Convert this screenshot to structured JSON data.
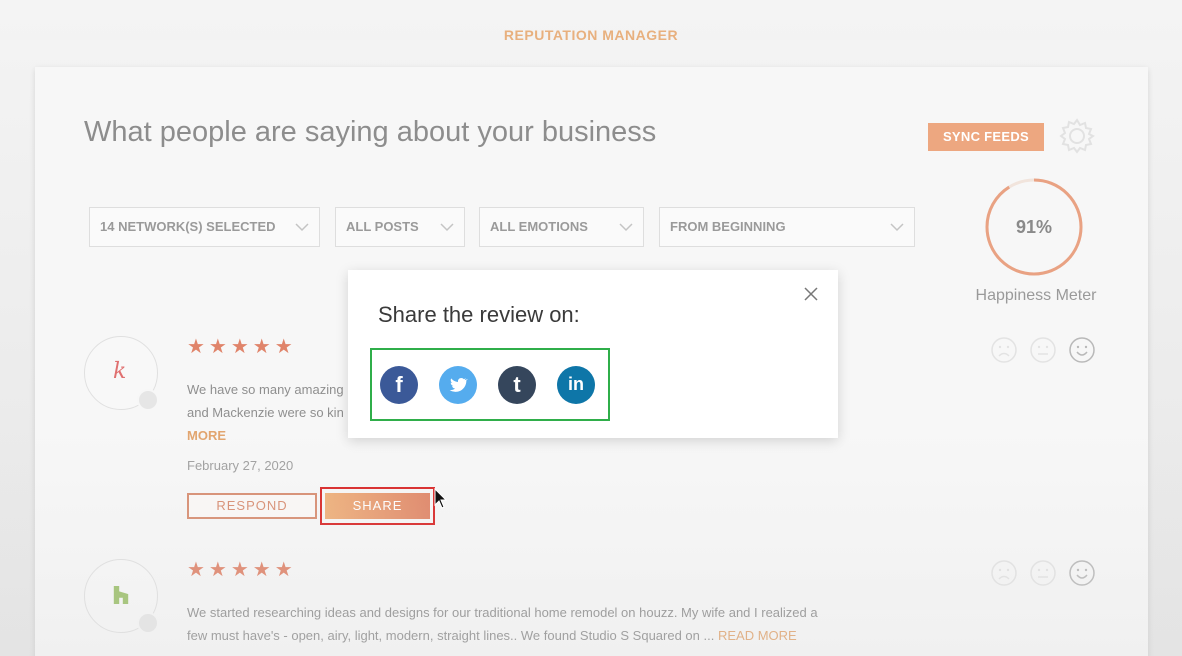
{
  "app": {
    "title": "REPUTATION MANAGER"
  },
  "header": {
    "heading": "What people are saying about your business",
    "sync_label": "SYNC FEEDS"
  },
  "filters": [
    {
      "label": "14 NETWORK(S) SELECTED"
    },
    {
      "label": "ALL POSTS"
    },
    {
      "label": "ALL EMOTIONS"
    },
    {
      "label": "FROM BEGINNING"
    }
  ],
  "happiness_meter": {
    "value": "91%",
    "fraction": 0.91,
    "label": "Happiness Meter"
  },
  "reviews": [
    {
      "avatar_letter": "k",
      "stars": "★★★★★",
      "text_line1": "We have so many amazing",
      "text_line2": "and Mackenzie were so kin",
      "more": "MORE",
      "date": "February 27, 2020",
      "respond_label": "RESPOND",
      "share_label": "SHARE"
    },
    {
      "avatar_letter": "h",
      "stars": "★★★★★",
      "text_line1": "We started researching ideas and designs for our traditional home remodel on houzz. My wife and I realized a",
      "text_line2": "few must have's - open, airy, light, modern, straight lines.. We found Studio S Squared on ...",
      "more": "READ MORE"
    }
  ],
  "share_modal": {
    "title": "Share the review on:",
    "networks": [
      {
        "name": "facebook",
        "glyph": "f",
        "color": "#3b5998"
      },
      {
        "name": "twitter",
        "glyph": "t",
        "color": "#55acee"
      },
      {
        "name": "tumblr",
        "glyph": "t",
        "color": "#35465c"
      },
      {
        "name": "linkedin",
        "glyph": "in",
        "color": "#0e76a8"
      }
    ]
  },
  "colors": {
    "accent": "#eda780",
    "star": "#e0846a",
    "highlight_red": "#d92727",
    "highlight_green": "#2fae4a"
  }
}
